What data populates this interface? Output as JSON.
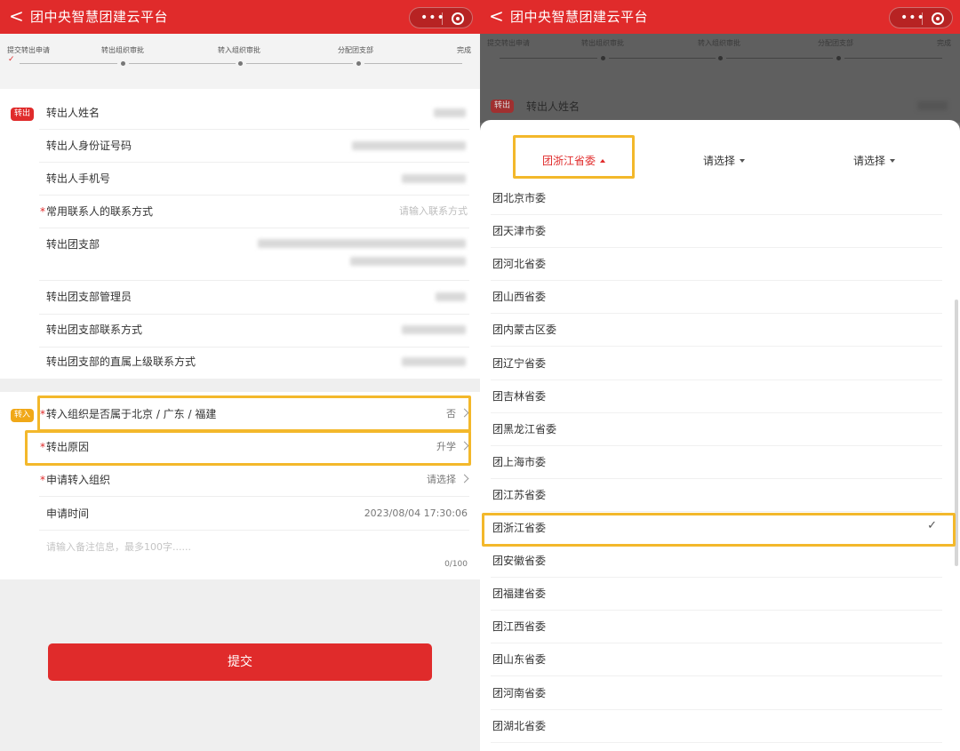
{
  "app": {
    "title": "团中央智慧团建云平台",
    "back_glyph": "<",
    "more_glyph": "•••"
  },
  "stepper": {
    "steps": [
      "提交转出申请",
      "转出组织审批",
      "转入组织审批",
      "分配团支部",
      "完成"
    ],
    "done_mark": "✓"
  },
  "out_section": {
    "tag": "转出",
    "rows": [
      {
        "label": "转出人姓名",
        "value": ""
      },
      {
        "label": "转出人身份证号码",
        "value": ""
      },
      {
        "label": "转出人手机号",
        "value": ""
      },
      {
        "label": "常用联系人的联系方式",
        "required": true,
        "placeholder": "请输入联系方式"
      },
      {
        "label": "转出团支部",
        "value": ""
      },
      {
        "label": "转出团支部管理员",
        "value": ""
      },
      {
        "label": "转出团支部联系方式",
        "value": ""
      },
      {
        "label": "转出团支部的直属上级联系方式",
        "value": ""
      }
    ]
  },
  "in_section": {
    "tag": "转入",
    "rows": [
      {
        "label": "转入组织是否属于北京 / 广东 / 福建",
        "required": true,
        "value": "否"
      },
      {
        "label": "转出原因",
        "required": true,
        "value": "升学"
      },
      {
        "label": "申请转入组织",
        "required": true,
        "value": "请选择"
      },
      {
        "label": "申请时间",
        "value": "2023/08/04 17:30:06"
      }
    ],
    "remark_placeholder": "请输入备注信息，最多100字......",
    "remark_counter": "0/100"
  },
  "required_mark": "*",
  "submit_label": "提交",
  "picker": {
    "tabs": [
      {
        "label": "团浙江省委",
        "active": true
      },
      {
        "label": "请选择",
        "active": false
      },
      {
        "label": "请选择",
        "active": false
      }
    ],
    "options": [
      "团北京市委",
      "团天津市委",
      "团河北省委",
      "团山西省委",
      "团内蒙古区委",
      "团辽宁省委",
      "团吉林省委",
      "团黑龙江省委",
      "团上海市委",
      "团江苏省委",
      "团浙江省委",
      "团安徽省委",
      "团福建省委",
      "团江西省委",
      "团山东省委",
      "团河南省委",
      "团湖北省委"
    ],
    "selected": "团浙江省委",
    "check_glyph": "✓"
  },
  "colors": {
    "brand_red": "#e02b2b",
    "highlight": "#f3b82b",
    "in_tag": "#f0a818"
  }
}
